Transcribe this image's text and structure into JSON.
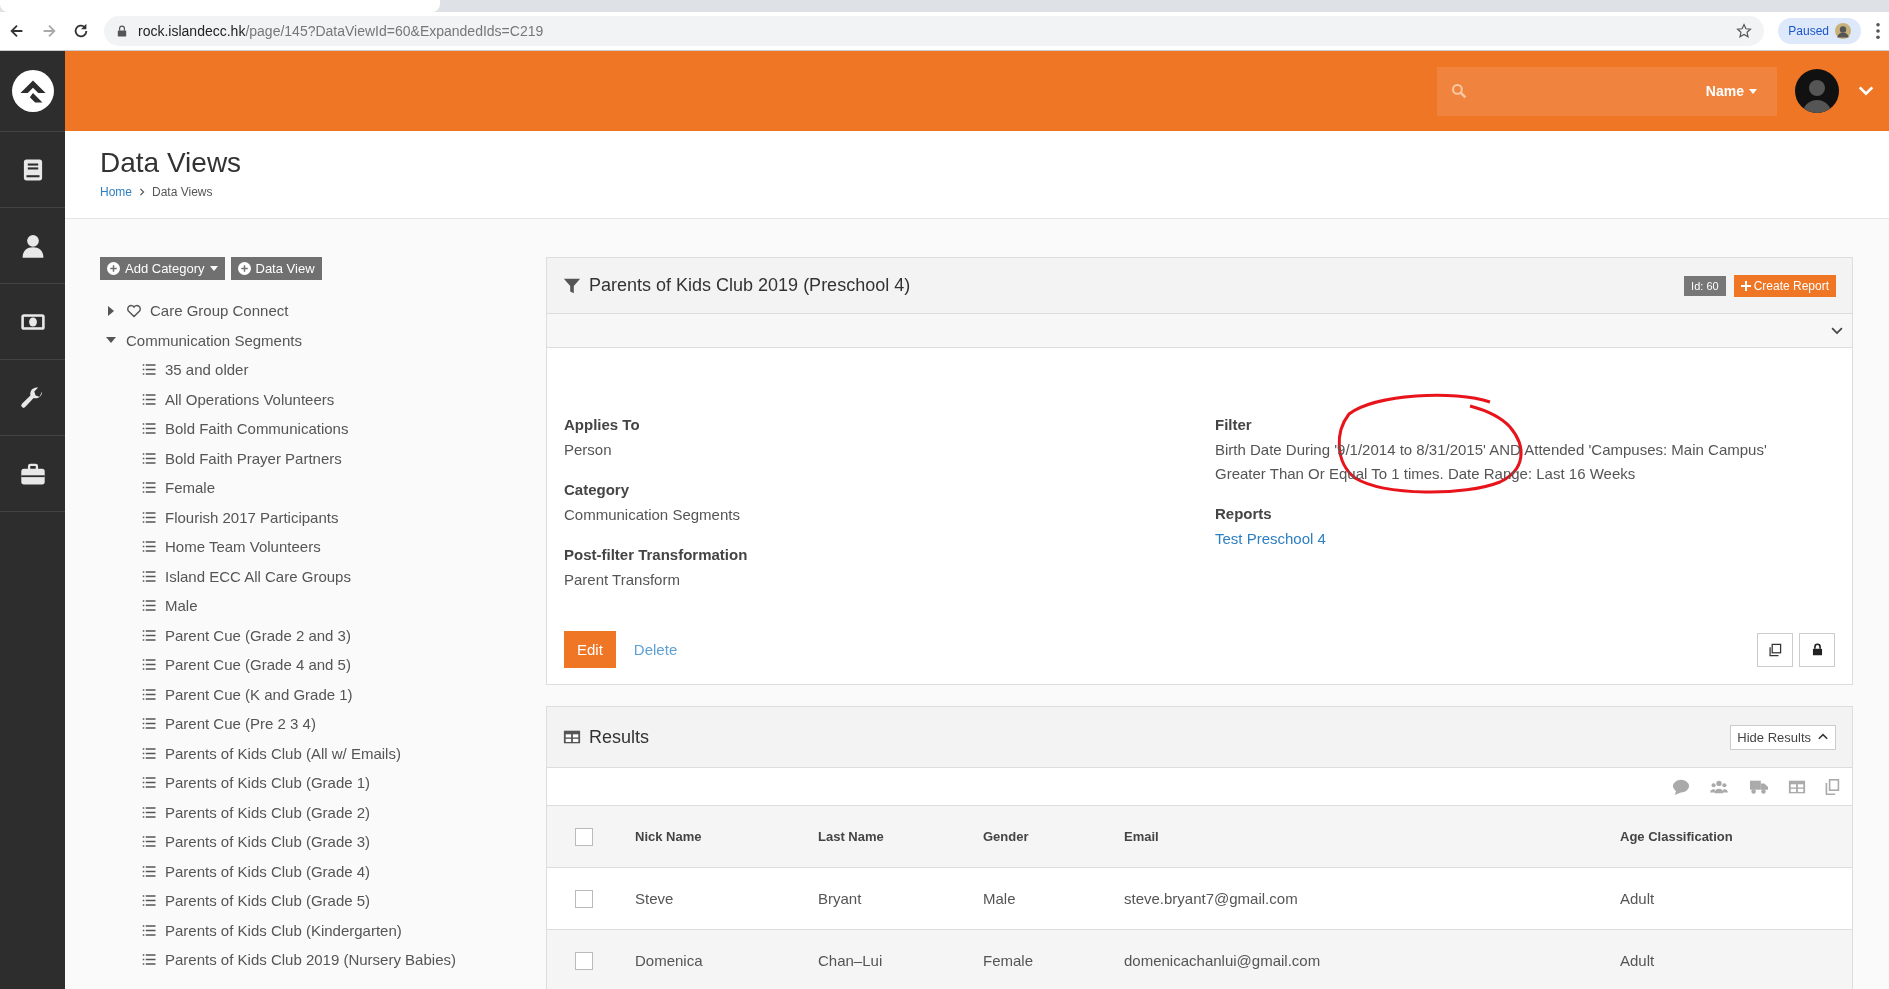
{
  "browser": {
    "url_host": "rock.islandecc.hk",
    "url_path": "/page/145?DataViewId=60&ExpandedIds=C219",
    "profile_label": "Paused"
  },
  "header": {
    "search_scope": "Name"
  },
  "page": {
    "title": "Data Views",
    "breadcrumbs": [
      {
        "label": "Home",
        "link": true
      },
      {
        "label": "Data Views",
        "link": false
      }
    ]
  },
  "tree": {
    "buttons": [
      {
        "label": "Add Category",
        "caret": true
      },
      {
        "label": "Data View",
        "caret": false
      }
    ],
    "items": [
      {
        "label": "Care Group Connect",
        "kind": "favorite",
        "expanded": false
      },
      {
        "label": "Communication Segments",
        "kind": "category",
        "expanded": true,
        "children": [
          {
            "label": "35 and older",
            "kind": "view"
          },
          {
            "label": "All Operations Volunteers",
            "kind": "view"
          },
          {
            "label": "Bold Faith Communications",
            "kind": "view"
          },
          {
            "label": "Bold Faith Prayer Partners",
            "kind": "view"
          },
          {
            "label": "Female",
            "kind": "view"
          },
          {
            "label": "Flourish 2017 Participants",
            "kind": "view"
          },
          {
            "label": "Home Team Volunteers",
            "kind": "view"
          },
          {
            "label": "Island ECC All Care Groups",
            "kind": "view"
          },
          {
            "label": "Male",
            "kind": "view"
          },
          {
            "label": "Parent Cue (Grade 2 and 3)",
            "kind": "view"
          },
          {
            "label": "Parent Cue (Grade 4 and 5)",
            "kind": "view"
          },
          {
            "label": "Parent Cue (K and Grade 1)",
            "kind": "view"
          },
          {
            "label": "Parent Cue (Pre 2 3 4)",
            "kind": "view"
          },
          {
            "label": "Parents of Kids Club (All w/ Emails)",
            "kind": "view"
          },
          {
            "label": "Parents of Kids Club (Grade 1)",
            "kind": "view"
          },
          {
            "label": "Parents of Kids Club (Grade 2)",
            "kind": "view"
          },
          {
            "label": "Parents of Kids Club (Grade 3)",
            "kind": "view"
          },
          {
            "label": "Parents of Kids Club (Grade 4)",
            "kind": "view"
          },
          {
            "label": "Parents of Kids Club (Grade 5)",
            "kind": "view"
          },
          {
            "label": "Parents of Kids Club (Kindergarten)",
            "kind": "view"
          },
          {
            "label": "Parents of Kids Club 2019 (Nursery Babies)",
            "kind": "view"
          }
        ]
      }
    ]
  },
  "detail": {
    "title": "Parents of Kids Club 2019 (Preschool 4)",
    "id_badge": "Id: 60",
    "create_report": "Create Report",
    "left_fields": [
      {
        "label": "Applies To",
        "value": "Person"
      },
      {
        "label": "Category",
        "value": "Communication Segments"
      },
      {
        "label": "Post-filter Transformation",
        "value": "Parent Transform"
      }
    ],
    "filter": {
      "label": "Filter",
      "value": "Birth Date During '9/1/2014 to 8/31/2015' AND Attended 'Campuses: Main Campus' Greater Than Or Equal To 1 times. Date Range: Last 16 Weeks"
    },
    "reports": {
      "label": "Reports",
      "links": [
        "Test Preschool 4"
      ]
    },
    "edit": "Edit",
    "delete": "Delete"
  },
  "results": {
    "title": "Results",
    "hide_button": "Hide Results",
    "all_selected": false,
    "columns": [
      "Nick Name",
      "Last Name",
      "Gender",
      "Email",
      "Age Classification"
    ],
    "rows": [
      {
        "selected": false,
        "cells": [
          "Steve",
          "Bryant",
          "Male",
          "steve.bryant7@gmail.com",
          "Adult"
        ]
      },
      {
        "selected": false,
        "cells": [
          "Domenica",
          "Chan–Lui",
          "Female",
          "domenicachanlui@gmail.com",
          "Adult"
        ]
      }
    ]
  }
}
